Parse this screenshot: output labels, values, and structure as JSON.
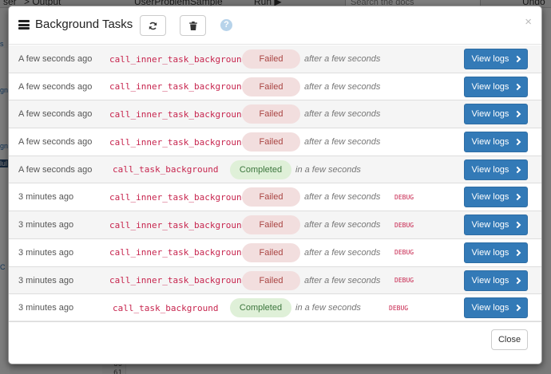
{
  "background": {
    "top_items": [
      "ser",
      "> Output",
      "UserProblemSample",
      "Run ▶",
      "Search the docs",
      "Undo"
    ],
    "left_labels": [
      "gn",
      "gn",
      "lul",
      "s",
      "C"
    ],
    "line_numbers": [
      "60",
      "61"
    ]
  },
  "modal": {
    "title": "Background Tasks",
    "title_icon": "tasks-list-icon",
    "refresh_icon": "refresh-icon",
    "delete_icon": "trash-icon",
    "help_icon": "help-icon",
    "help_glyph": "?",
    "close_glyph": "×",
    "close_button_label": "Close",
    "view_logs_label": "View logs",
    "colors": {
      "primary": "#337ab7",
      "failed_bg": "#f2dede",
      "failed_text": "#a94442",
      "completed_bg": "#dff0d8",
      "completed_text": "#3c763d",
      "function_text": "#c7254e"
    }
  },
  "tasks": [
    {
      "time": "A few seconds ago",
      "function": "call_inner_task_background",
      "status": "Failed",
      "eta": "after a few seconds",
      "debug": ""
    },
    {
      "time": "A few seconds ago",
      "function": "call_inner_task_background",
      "status": "Failed",
      "eta": "after a few seconds",
      "debug": ""
    },
    {
      "time": "A few seconds ago",
      "function": "call_inner_task_background",
      "status": "Failed",
      "eta": "after a few seconds",
      "debug": ""
    },
    {
      "time": "A few seconds ago",
      "function": "call_inner_task_background",
      "status": "Failed",
      "eta": "after a few seconds",
      "debug": ""
    },
    {
      "time": "A few seconds ago",
      "function": "call_task_background",
      "status": "Completed",
      "eta": "in a few seconds",
      "debug": ""
    },
    {
      "time": "3 minutes ago",
      "function": "call_inner_task_background",
      "status": "Failed",
      "eta": "after a few seconds",
      "debug": "DEBUG"
    },
    {
      "time": "3 minutes ago",
      "function": "call_inner_task_background",
      "status": "Failed",
      "eta": "after a few seconds",
      "debug": "DEBUG"
    },
    {
      "time": "3 minutes ago",
      "function": "call_inner_task_background",
      "status": "Failed",
      "eta": "after a few seconds",
      "debug": "DEBUG"
    },
    {
      "time": "3 minutes ago",
      "function": "call_inner_task_background",
      "status": "Failed",
      "eta": "after a few seconds",
      "debug": "DEBUG"
    },
    {
      "time": "3 minutes ago",
      "function": "call_task_background",
      "status": "Completed",
      "eta": "in a few seconds",
      "debug": "DEBUG"
    }
  ]
}
